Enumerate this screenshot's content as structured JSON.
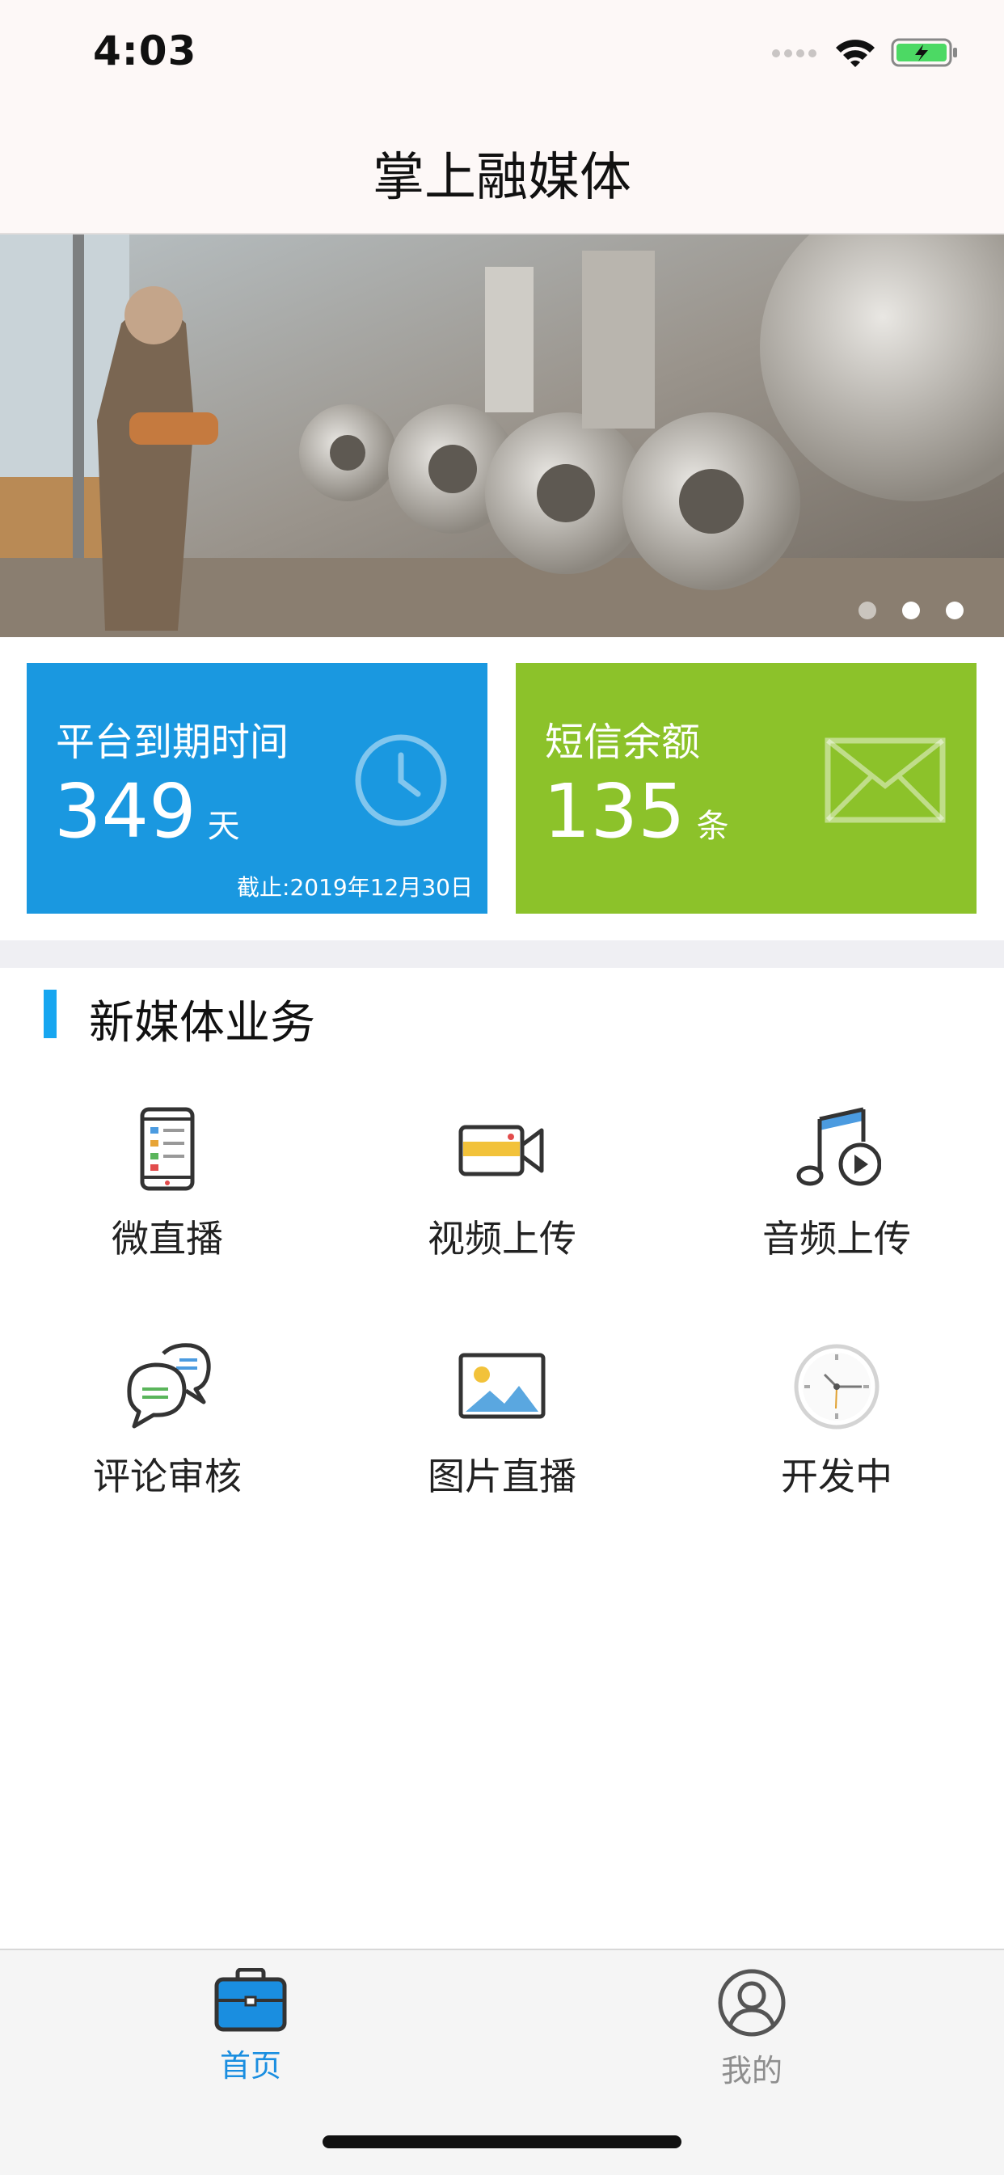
{
  "status_bar": {
    "time": "4:03"
  },
  "nav": {
    "title": "掌上融媒体"
  },
  "banner": {
    "slide_count": 3,
    "active_slide": 3
  },
  "cards": {
    "platform": {
      "title": "平台到期时间",
      "value": "349",
      "unit": "天",
      "note": "截止:2019年12月30日",
      "color": "#1a98e0",
      "icon": "clock-icon"
    },
    "sms": {
      "title": "短信余额",
      "value": "135",
      "unit": "条",
      "color": "#8cc22a",
      "icon": "envelope-icon"
    }
  },
  "section": {
    "title": "新媒体业务",
    "accent": "#17a6f0"
  },
  "services": [
    {
      "label": "微直播",
      "icon": "phone-live-icon"
    },
    {
      "label": "视频上传",
      "icon": "video-camera-icon"
    },
    {
      "label": "音频上传",
      "icon": "music-note-icon"
    },
    {
      "label": "评论审核",
      "icon": "comment-bubbles-icon"
    },
    {
      "label": "图片直播",
      "icon": "picture-icon"
    },
    {
      "label": "开发中",
      "icon": "clock-icon"
    }
  ],
  "tabbar": {
    "home": {
      "label": "首页",
      "icon": "briefcase-icon",
      "active": true,
      "color": "#1a8ee0"
    },
    "mine": {
      "label": "我的",
      "icon": "user-icon",
      "active": false,
      "color": "#8e8e8e"
    }
  }
}
